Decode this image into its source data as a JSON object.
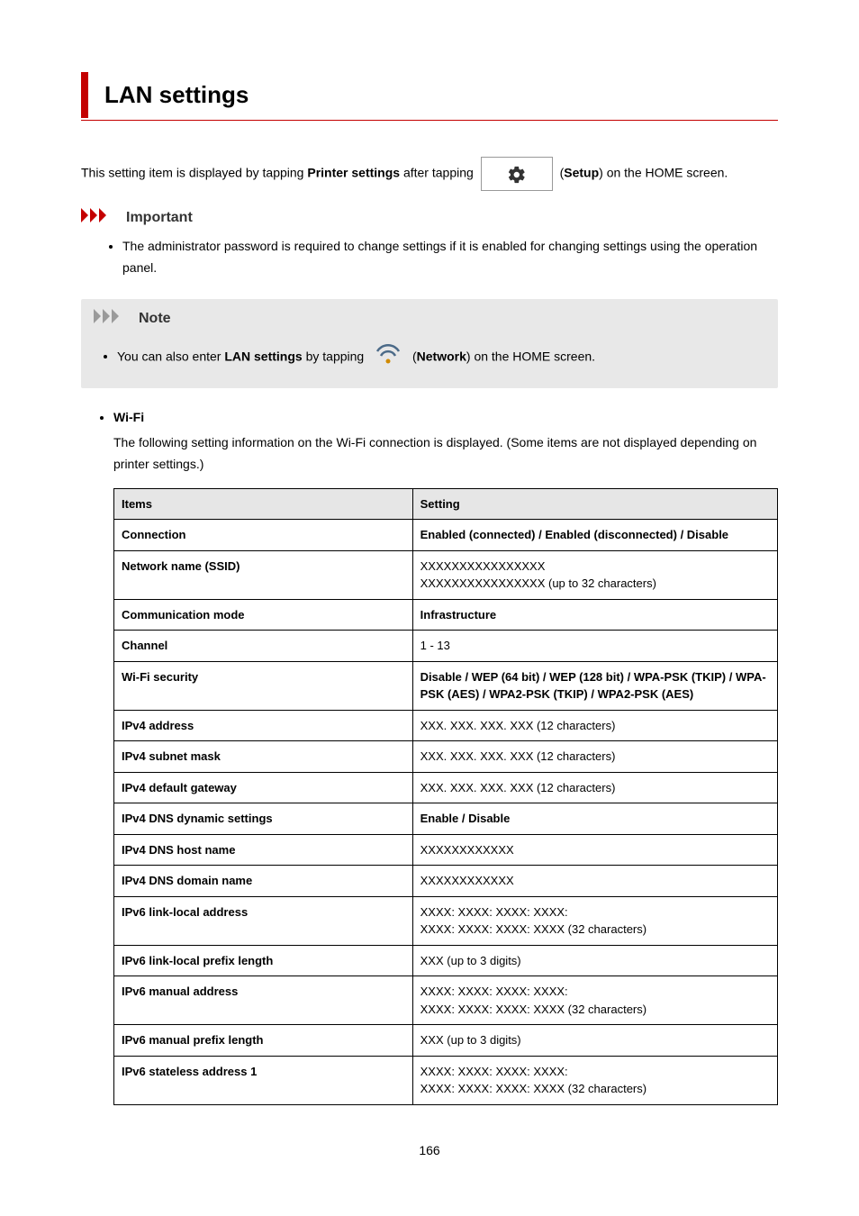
{
  "title": "LAN settings",
  "intro": {
    "prefix": "This setting item is displayed by tapping ",
    "printer_settings": "Printer settings",
    "mid": " after tapping ",
    "setup_label": "Setup",
    "suffix": ") on the HOME screen."
  },
  "important": {
    "heading": "Important",
    "bullet": "The administrator password is required to change settings if it is enabled for changing settings using the operation panel."
  },
  "note": {
    "heading": "Note",
    "prefix": "You can also enter ",
    "lan_settings": "LAN settings",
    "mid": " by tapping ",
    "network_label": "Network",
    "suffix": ") on the HOME screen."
  },
  "wifi": {
    "label": "Wi-Fi",
    "desc": "The following setting information on the Wi-Fi connection is displayed. (Some items are not displayed depending on printer settings.)"
  },
  "table": {
    "headers": [
      "Items",
      "Setting"
    ],
    "rows": [
      {
        "item": "Connection",
        "item_bold": true,
        "setting": "Enabled (connected) / Enabled (disconnected) / Disable",
        "setting_bold": true
      },
      {
        "item": "Network name (SSID)",
        "item_bold": true,
        "setting": "XXXXXXXXXXXXXXXX\nXXXXXXXXXXXXXXXX (up to 32 characters)",
        "setting_bold": false
      },
      {
        "item": "Communication mode",
        "item_bold": true,
        "setting": "Infrastructure",
        "setting_bold": true
      },
      {
        "item": "Channel",
        "item_bold": true,
        "setting": "1 - 13",
        "setting_bold": false
      },
      {
        "item": "Wi-Fi security",
        "item_bold": true,
        "setting": "Disable / WEP (64 bit) / WEP (128 bit) / WPA-PSK (TKIP) / WPA-PSK (AES) / WPA2-PSK (TKIP) / WPA2-PSK (AES)",
        "setting_bold": true
      },
      {
        "item": "IPv4 address",
        "item_bold": true,
        "setting": "XXX. XXX. XXX. XXX (12 characters)",
        "setting_bold": false
      },
      {
        "item": "IPv4 subnet mask",
        "item_bold": true,
        "setting": "XXX. XXX. XXX. XXX (12 characters)",
        "setting_bold": false
      },
      {
        "item": "IPv4 default gateway",
        "item_bold": true,
        "setting": "XXX. XXX. XXX. XXX (12 characters)",
        "setting_bold": false
      },
      {
        "item": "IPv4 DNS dynamic settings",
        "item_bold": true,
        "setting": "Enable / Disable",
        "setting_bold": true
      },
      {
        "item": "IPv4 DNS host name",
        "item_bold": true,
        "setting": "XXXXXXXXXXXX",
        "setting_bold": false
      },
      {
        "item": "IPv4 DNS domain name",
        "item_bold": true,
        "setting": "XXXXXXXXXXXX",
        "setting_bold": false
      },
      {
        "item": "IPv6 link-local address",
        "item_bold": true,
        "setting": "XXXX: XXXX: XXXX: XXXX:\nXXXX: XXXX: XXXX: XXXX (32 characters)",
        "setting_bold": false
      },
      {
        "item": "IPv6 link-local prefix length",
        "item_bold": true,
        "setting": "XXX (up to 3 digits)",
        "setting_bold": false
      },
      {
        "item": "IPv6 manual address",
        "item_bold": true,
        "setting": "XXXX: XXXX: XXXX: XXXX:\nXXXX: XXXX: XXXX: XXXX (32 characters)",
        "setting_bold": false
      },
      {
        "item": "IPv6 manual prefix length",
        "item_bold": true,
        "setting": "XXX (up to 3 digits)",
        "setting_bold": false
      },
      {
        "item": "IPv6 stateless address 1",
        "item_bold": true,
        "setting": "XXXX: XXXX: XXXX: XXXX:\nXXXX: XXXX: XXXX: XXXX (32 characters)",
        "setting_bold": false
      }
    ]
  },
  "page_number": "166"
}
